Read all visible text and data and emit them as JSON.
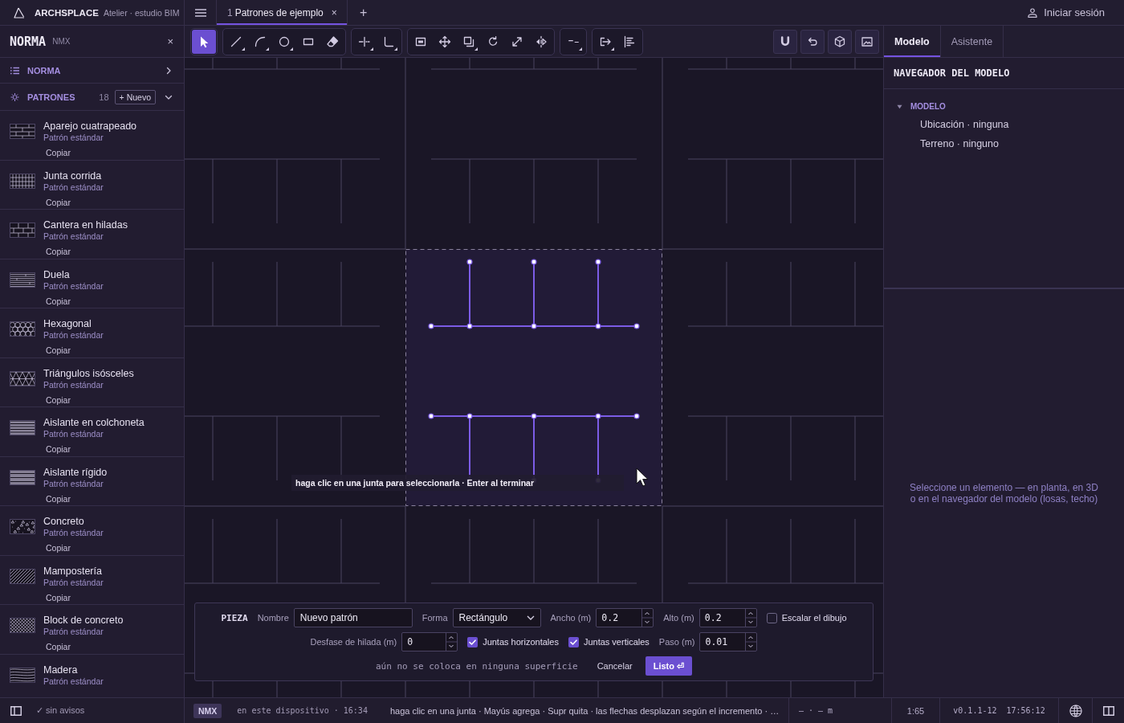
{
  "app_bar": {
    "brand": "ARCHSPLACE",
    "subtitle": "Atelier · estudio BIM",
    "tabs": [
      {
        "number": "1",
        "title": "Patrones de ejemplo",
        "close": "×",
        "selected": true
      }
    ],
    "add_tab": "+",
    "sign_in": "Iniciar sesión"
  },
  "sidebar": {
    "title": "NORMA",
    "code": "NMX",
    "close": "×",
    "sections": [
      {
        "label": "NORMA",
        "expanded": false
      },
      {
        "label": "PATRONES",
        "expanded": true,
        "count": "18",
        "new_button": "+ Nuevo"
      }
    ],
    "patterns": [
      {
        "kind": "running-bond",
        "name": "Aparejo cuatrapeado",
        "subtitle": "Patrón estándar",
        "action": "Copiar"
      },
      {
        "kind": "grid",
        "name": "Junta corrida",
        "subtitle": "Patrón estándar",
        "action": "Copiar"
      },
      {
        "kind": "ashlar",
        "name": "Cantera en hiladas",
        "subtitle": "Patrón estándar",
        "action": "Copiar"
      },
      {
        "kind": "boards",
        "name": "Duela",
        "subtitle": "Patrón estándar",
        "action": "Copiar"
      },
      {
        "kind": "hexagon",
        "name": "Hexagonal",
        "subtitle": "Patrón estándar",
        "action": "Copiar"
      },
      {
        "kind": "triangles",
        "name": "Triángulos isósceles",
        "subtitle": "Patrón estándar",
        "action": "Copiar"
      },
      {
        "kind": "batt",
        "name": "Aislante en colchoneta",
        "subtitle": "Patrón estándar",
        "action": "Copiar"
      },
      {
        "kind": "rigid",
        "name": "Aislante rígido",
        "subtitle": "Patrón estándar",
        "action": "Copiar"
      },
      {
        "kind": "concrete",
        "name": "Concreto",
        "subtitle": "Patrón estándar",
        "action": "Copiar"
      },
      {
        "kind": "hatch",
        "name": "Mampostería",
        "subtitle": "Patrón estándar",
        "action": "Copiar"
      },
      {
        "kind": "crosshatch",
        "name": "Block de concreto",
        "subtitle": "Patrón estándar",
        "action": "Copiar"
      },
      {
        "kind": "wood",
        "name": "Madera",
        "subtitle": "Patrón estándar"
      }
    ]
  },
  "toolbar": {
    "groups": [
      {
        "tools": [
          {
            "kind": "select",
            "selected": true,
            "submenu": false
          }
        ]
      },
      {
        "tools": [
          {
            "kind": "line",
            "selected": false,
            "submenu": true
          },
          {
            "kind": "arc",
            "selected": false,
            "submenu": true
          },
          {
            "kind": "circle",
            "selected": false,
            "submenu": true
          },
          {
            "kind": "rectangle",
            "selected": false,
            "submenu": false
          },
          {
            "kind": "eraser",
            "selected": false,
            "submenu": false
          }
        ]
      },
      {
        "tools": [
          {
            "kind": "split",
            "selected": false,
            "submenu": true
          },
          {
            "kind": "corner",
            "selected": false,
            "submenu": true
          }
        ]
      },
      {
        "tools": [
          {
            "kind": "frame",
            "selected": false,
            "submenu": false
          },
          {
            "kind": "move",
            "selected": false,
            "submenu": false
          },
          {
            "kind": "copy",
            "selected": false,
            "submenu": true
          },
          {
            "kind": "rotate",
            "selected": false,
            "submenu": false
          },
          {
            "kind": "scale",
            "selected": false,
            "submenu": false
          },
          {
            "kind": "mirror",
            "selected": false,
            "submenu": false
          }
        ]
      },
      {
        "tools": [
          {
            "kind": "dash",
            "selected": false,
            "submenu": true
          }
        ]
      },
      {
        "tools": [
          {
            "kind": "offset",
            "selected": false,
            "submenu": true
          },
          {
            "kind": "align",
            "selected": false,
            "submenu": false
          }
        ]
      }
    ],
    "view_buttons": [
      {
        "kind": "magnet"
      },
      {
        "kind": "undo"
      },
      {
        "kind": "cube"
      },
      {
        "kind": "image"
      }
    ]
  },
  "canvas": {
    "hint_tooltip": "haga clic en una junta para seleccionarla · Enter al terminar"
  },
  "piece_form": {
    "title": "PIEZA",
    "rows": [
      {
        "fields": [
          {
            "kind": "text",
            "label": "Nombre",
            "value": "Nuevo patrón"
          },
          {
            "kind": "select",
            "label": "Forma",
            "value": "Rectángulo"
          },
          {
            "kind": "number",
            "label": "Ancho (m)",
            "value": "0.2"
          },
          {
            "kind": "number",
            "label": "Alto (m)",
            "value": "0.2"
          },
          {
            "kind": "checkbox",
            "label": "Escalar el dibujo",
            "checked": false
          }
        ]
      },
      {
        "fields": [
          {
            "kind": "number",
            "label": "Desfase de hilada (m)",
            "value": "0"
          },
          {
            "kind": "checkbox",
            "label": "Juntas horizontales",
            "checked": true
          },
          {
            "kind": "checkbox",
            "label": "Juntas verticales",
            "checked": true
          },
          {
            "kind": "number",
            "label": "Paso (m)",
            "value": "0.01"
          }
        ]
      }
    ],
    "status": "aún no se coloca en ninguna superficie",
    "buttons": [
      {
        "label": "Cancelar",
        "kind": "secondary"
      },
      {
        "label": "Listo ⏎",
        "kind": "primary"
      }
    ]
  },
  "inspector": {
    "tabs": [
      {
        "label": "Modelo",
        "selected": true
      },
      {
        "label": "Asistente",
        "selected": false
      }
    ],
    "navigator": {
      "title": "NAVEGADOR DEL MODELO",
      "tree": [
        {
          "label": "MODELO",
          "expanded": true,
          "children": [
            {
              "label": "Ubicación · ninguna"
            },
            {
              "label": "Terreno · ninguno"
            }
          ]
        }
      ]
    },
    "empty_message": "Seleccione un elemento — en planta, en 3D\no en el navegador del modelo (losas, techo)"
  },
  "status_bar": {
    "warnings": "✓ sin avisos",
    "standard": "NMX",
    "saved": "en este dispositivo · 16:34",
    "hint": "haga clic en una junta · Mayús agrega · Supr quita · las flechas desplazan según el incremento · …",
    "coordinates": "— · — m",
    "scale": "1:65",
    "version": "v0.1.1-12",
    "clock": "17:56:12"
  }
}
